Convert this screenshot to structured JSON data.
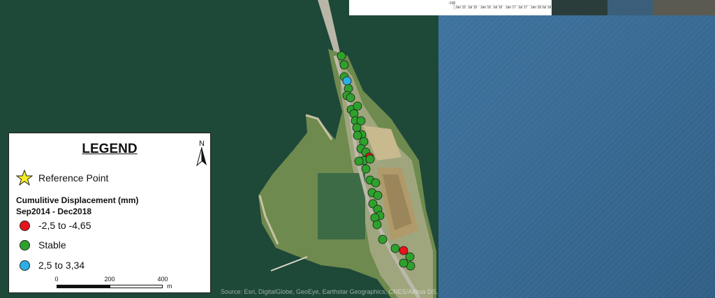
{
  "legend": {
    "title": "LEGEND",
    "north_label": "N",
    "reference_label": "Reference Point",
    "displacement_label_line1": "Cumulitive Displacement (mm)",
    "displacement_label_line2": "Sep2014 - Dec2018",
    "classes": [
      {
        "label": "-2,5  to -4,65",
        "color": "#e8141b"
      },
      {
        "label": "Stable",
        "color": "#2ea12c"
      },
      {
        "label": "2,5 to 3,34",
        "color": "#2ab0e6"
      }
    ],
    "scale": {
      "ticks": [
        "0",
        "200",
        "400"
      ],
      "unit": "m"
    }
  },
  "attribution": "Source: Esri, DigitalGlobe, GeoEye, Earthstar Geographics, CNES/Airbus DS,",
  "inset_chart": {
    "y_tick": "-100",
    "x_ticks": [
      "Jan 15",
      "Jul 15",
      "Jan 16",
      "Jul 16",
      "Jan 17",
      "Jul 17",
      "Jan 18",
      "Jul 18"
    ]
  },
  "colors": {
    "water": "#1f4a3a",
    "sea": "#3a6e96",
    "land": "#7f9a5a",
    "stable": "#2ea12c",
    "negative": "#e8141b",
    "positive": "#2ab0e6"
  }
}
